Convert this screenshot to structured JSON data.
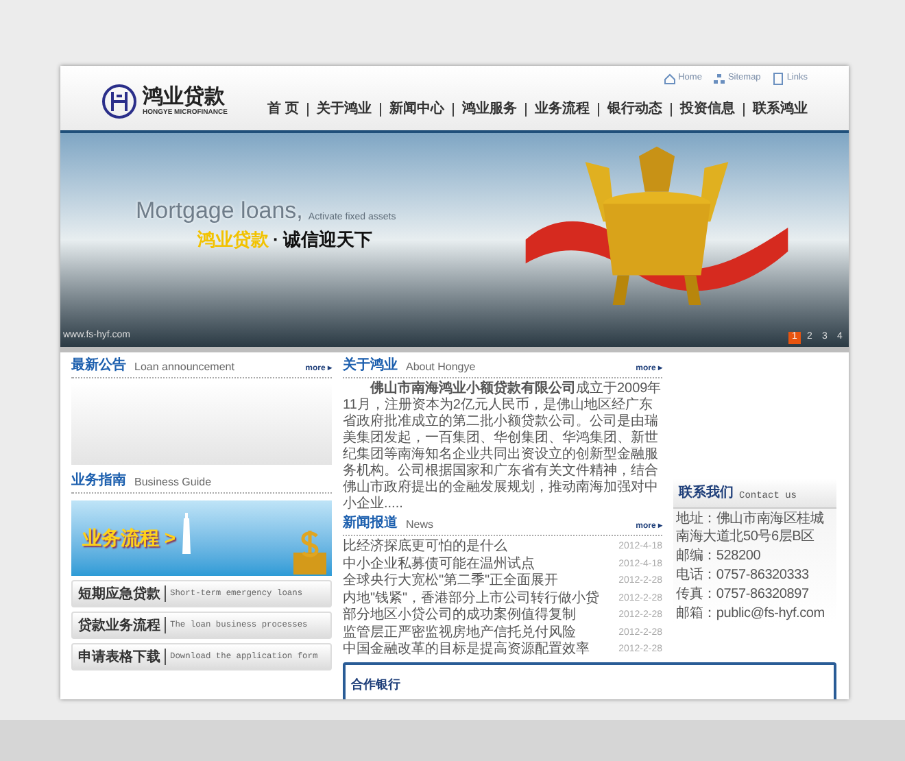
{
  "header": {
    "logo": {
      "name": "鸿业贷款",
      "subtitle": "HONGYE MICROFINANCE"
    },
    "top_links": [
      {
        "label": "Home",
        "kind": "home"
      },
      {
        "label": "Sitemap",
        "kind": "sitemap"
      },
      {
        "label": "Links",
        "kind": "links"
      }
    ],
    "nav": [
      {
        "label": "首 页"
      },
      {
        "label": "关于鸿业"
      },
      {
        "label": "新闻中心"
      },
      {
        "label": "鸿业服务"
      },
      {
        "label": "业务流程"
      },
      {
        "label": "银行动态"
      },
      {
        "label": "投资信息"
      },
      {
        "label": "联系鸿业"
      }
    ]
  },
  "banner": {
    "headline": "Mortgage loans,",
    "subline": "Activate fixed assets",
    "slogan_brand": "鸿业贷款",
    "slogan_dot": "·",
    "slogan": "诚信迎天下",
    "url": "www.fs-hyf.com",
    "pages": [
      {
        "label": "1",
        "selected": true
      },
      {
        "label": "2",
        "selected": false
      },
      {
        "label": "3",
        "selected": false
      },
      {
        "label": "4",
        "selected": false
      }
    ]
  },
  "announcements": {
    "title": "最新公告",
    "subtitle": "Loan announcement",
    "more": "more ▸"
  },
  "business_guide": {
    "title": "业务指南",
    "subtitle": "Business Guide",
    "banner_text": "业务流程 >",
    "links": [
      {
        "label": "短期应急贷款",
        "english": "Short-term emergency loans"
      },
      {
        "label": "贷款业务流程",
        "english": "The loan business processes"
      },
      {
        "label": "申请表格下载",
        "english": "Download the application form"
      }
    ]
  },
  "about": {
    "title": "关于鸿业",
    "subtitle": "About Hongye",
    "more": "more ▸",
    "text": "**佛山市南海鸿业小额贷款有限公司**成立于2009年11月，注册资本为2亿元人民币，是佛山地区经广东省政府批准成立的第二批小额贷款公司。公司是由瑞美集团发起，一百集团、华创集团、华鸿集团、新世纪集团等南海知名企业共同出资设立的创新型金融服务机构。公司根据国家和广东省有关文件精神，结合佛山市政府提出的金融发展规划，推动南海加强对中小企业....."
  },
  "news": {
    "title": "新闻报道",
    "subtitle": "News",
    "more": "more ▸",
    "items": [
      {
        "title": "比经济探底更可怕的是什么",
        "date": "2012-4-18"
      },
      {
        "title": "中小企业私募债可能在温州试点",
        "date": "2012-4-18"
      },
      {
        "title": "全球央行大宽松\"第二季\"正全面展开",
        "date": "2012-2-28"
      },
      {
        "title": "内地\"钱紧\"，香港部分上市公司转行做小贷",
        "date": "2012-2-28"
      },
      {
        "title": "部分地区小贷公司的成功案例值得复制",
        "date": "2012-2-28"
      },
      {
        "title": "监管层正严密监视房地产信托兑付风险",
        "date": "2012-2-28"
      },
      {
        "title": "中国金融改革的目标是提高资源配置效率",
        "date": "2012-2-28"
      }
    ]
  },
  "contact": {
    "title": "联系我们",
    "subtitle": "Contact us",
    "lines": [
      "地址：佛山市南海区桂城南海大道北50号6层B区",
      "邮编：528200",
      "电话：0757-86320333",
      "传真：0757-86320897",
      "邮箱：public@fs-hyf.com"
    ]
  },
  "partners": {
    "title": "合作银行"
  }
}
